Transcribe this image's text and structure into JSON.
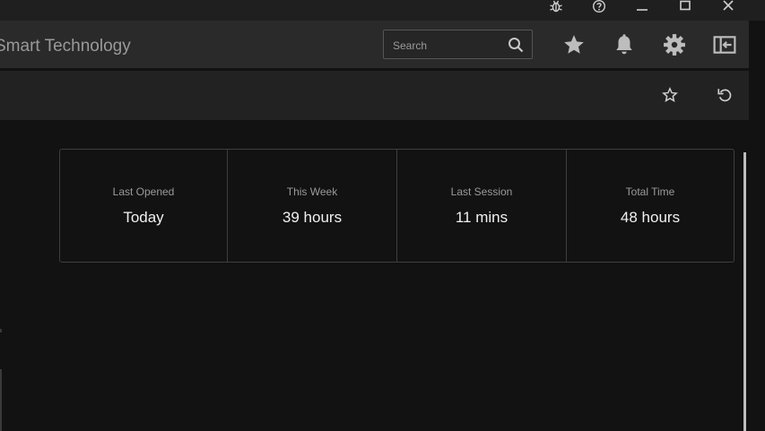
{
  "app": {
    "title": "Smart Technology"
  },
  "search": {
    "placeholder": "Search"
  },
  "window_controls": [
    "bug-icon",
    "help-icon",
    "minimize-icon",
    "maximize-icon",
    "close-icon"
  ],
  "header_icons": [
    "star-icon",
    "bell-icon",
    "gear-icon",
    "sidebar-panel-icon"
  ],
  "subbar_icons": [
    "star-outline-icon",
    "refresh-icon"
  ],
  "stats": [
    {
      "label": "Last Opened",
      "value": "Today"
    },
    {
      "label": "This Week",
      "value": "39 hours"
    },
    {
      "label": "Last Session",
      "value": "11 mins"
    },
    {
      "label": "Total Time",
      "value": "48 hours"
    }
  ],
  "colors": {
    "background": "#121212",
    "appbar": "#2a2a2a",
    "icon": "#bdbdbd",
    "border": "#3e3e3e"
  }
}
